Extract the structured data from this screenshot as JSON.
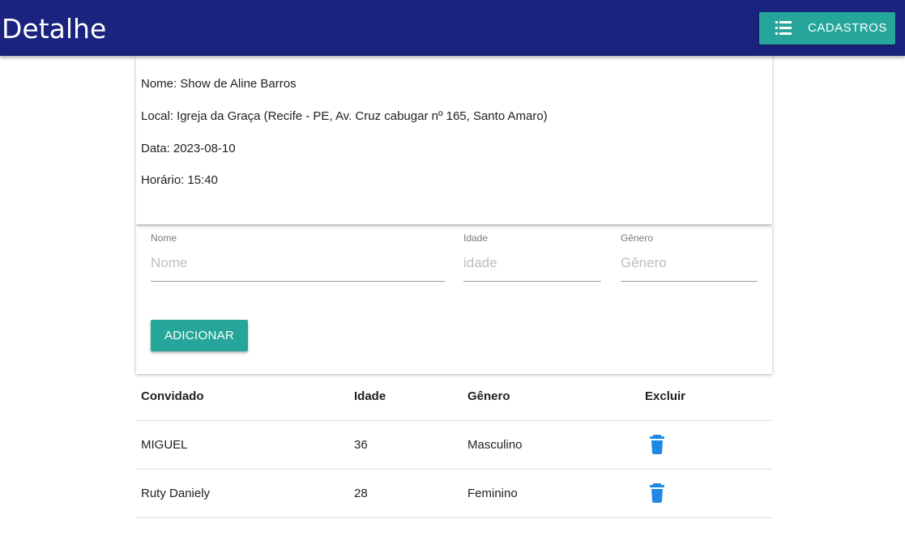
{
  "header": {
    "title": "Detalhe",
    "nav_button": {
      "icon": "list-icon",
      "label": "CADASTROS"
    }
  },
  "event": {
    "nome_label": "Nome:",
    "nome": "Show de Aline Barros",
    "local_label": "Local:",
    "local": "Igreja da Graça (Recife - PE, Av. Cruz cabugar nº 165, Santo Amaro)",
    "data_label": "Data:",
    "data": "2023-08-10",
    "horario_label": "Horário:",
    "horario": "15:40"
  },
  "form": {
    "nome": {
      "label": "Nome",
      "placeholder": "Nome",
      "value": ""
    },
    "idade": {
      "label": "Idade",
      "placeholder": "idade",
      "value": ""
    },
    "genero": {
      "label": "Gênero",
      "placeholder": "Gênero",
      "value": ""
    },
    "add_button": "ADICIONAR"
  },
  "table": {
    "headers": [
      "Convidado",
      "Idade",
      "Gênero",
      "Excluir"
    ],
    "rows": [
      {
        "convidado": "MIGUEL",
        "idade": "36",
        "genero": "Masculino",
        "excluir_icon": "trash-icon"
      },
      {
        "convidado": "Ruty Daniely",
        "idade": "28",
        "genero": "Feminino",
        "excluir_icon": "trash-icon"
      }
    ]
  },
  "colors": {
    "topbar": "#1a237e",
    "accent": "#26a69a",
    "trash": "#1e88e5"
  }
}
